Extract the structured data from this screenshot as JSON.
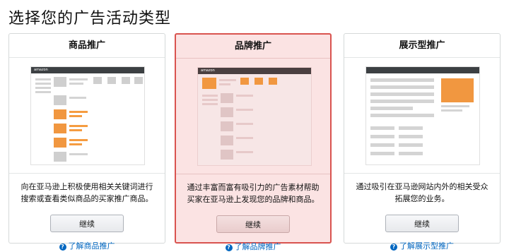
{
  "page": {
    "title": "选择您的广告活动类型"
  },
  "colors": {
    "accent": "#d9534f",
    "selected_bg": "#fbe3e3",
    "link": "#0066c0",
    "illustration_orange": "#f19740"
  },
  "cards": [
    {
      "title": "商品推广",
      "logo_text": "amazon",
      "description": "向在亚马逊上积极使用相关关键词进行搜索或查看类似商品的买家推广商品。",
      "button_label": "继续",
      "link_label": "了解商品推广",
      "selected": false
    },
    {
      "title": "品牌推广",
      "logo_text": "amazon",
      "description": "通过丰富而富有吸引力的广告素材帮助买家在亚马逊上发现您的品牌和商品。",
      "button_label": "继续",
      "link_label": "了解品牌推广",
      "selected": true
    },
    {
      "title": "展示型推广",
      "description": "通过吸引在亚马逊网站内外的相关受众拓展您的业务。",
      "button_label": "继续",
      "link_label": "了解展示型推广",
      "selected": false
    }
  ],
  "icons": {
    "help": "question-circle-icon",
    "image": "image-icon"
  }
}
